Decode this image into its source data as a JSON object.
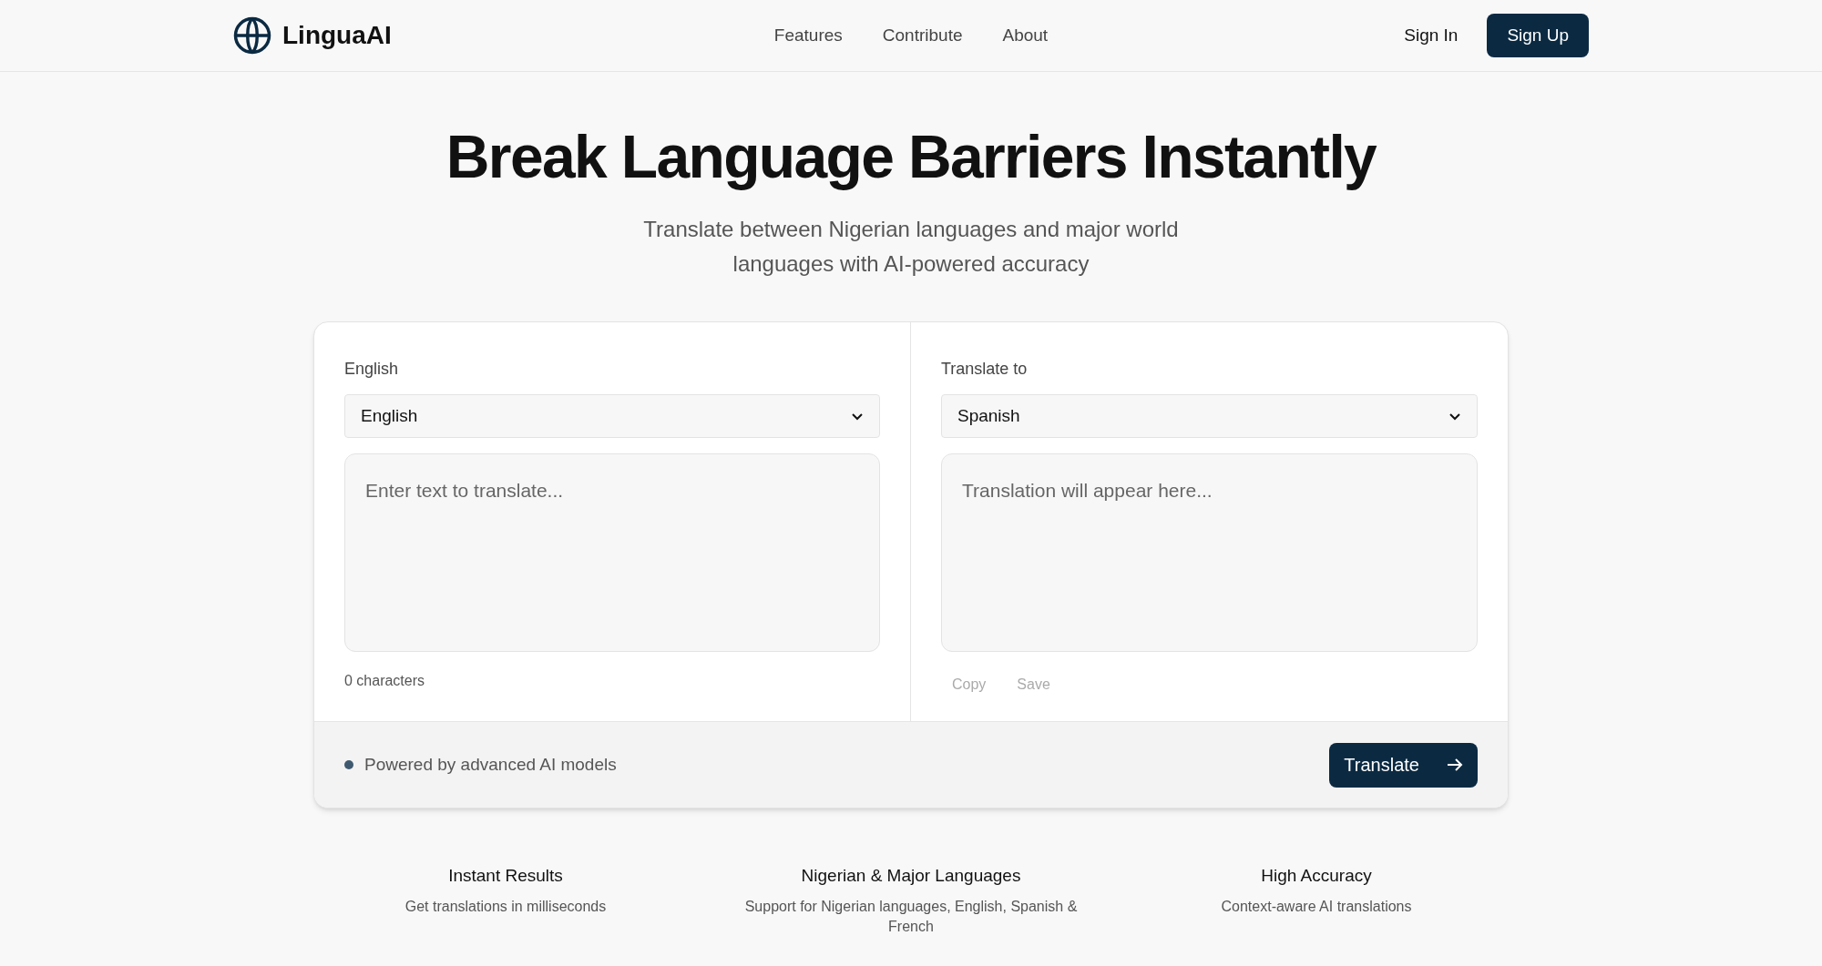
{
  "header": {
    "logo": "LinguaAI",
    "nav": [
      "Features",
      "Contribute",
      "About"
    ],
    "sign_in": "Sign In",
    "sign_up": "Sign Up"
  },
  "hero": {
    "title": "Break Language Barriers Instantly",
    "subtitle": "Translate between Nigerian languages and major world languages with AI-powered accuracy"
  },
  "translator": {
    "source": {
      "label": "English",
      "language": "English",
      "placeholder": "Enter text to translate...",
      "count": "0 characters"
    },
    "target": {
      "label": "Translate to",
      "language": "Spanish",
      "placeholder": "Translation will appear here...",
      "actions": [
        {
          "label": "Copy",
          "disabled": true
        },
        {
          "label": "Save",
          "disabled": true
        }
      ]
    },
    "footer": {
      "note": "Powered by advanced AI models",
      "button": "Translate"
    }
  },
  "features": [
    {
      "title": "Instant Results",
      "text": "Get translations in milliseconds"
    },
    {
      "title": "Nigerian & Major Languages",
      "text": "Support for Nigerian languages, English, Spanish & French"
    },
    {
      "title": "High Accuracy",
      "text": "Context-aware AI translations"
    }
  ]
}
